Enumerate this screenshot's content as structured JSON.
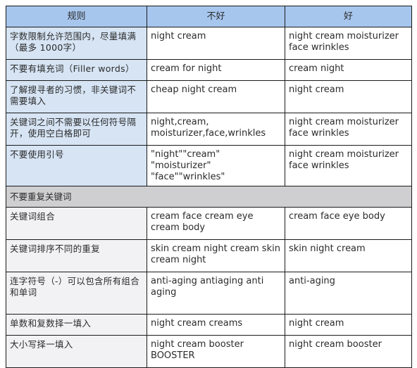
{
  "table": {
    "headers": [
      "规则",
      "不好",
      "好"
    ],
    "rows": [
      {
        "rule": "字数限制允许范围内，尽量填满（最多 1000字）",
        "bad": "night cream",
        "good": "night cream moisturizer face wrinkles"
      },
      {
        "rule": "不要有填充词（Filler words）",
        "bad": "cream for night",
        "good": "cream night"
      },
      {
        "rule": "了解搜寻者的习惯，非关键词不需要填入",
        "bad": "cheap night cream",
        "good": "night cream"
      },
      {
        "rule": "关键词之间不需要以任何符号隔开，使用空白格即可",
        "bad": "night,cream, moisturizer,face,wrinkles",
        "good": "night cream moisturizer face wrinkles"
      },
      {
        "rule": "不要使用引号",
        "bad": "\"night\"\"cream\" \"moisturizer\" \"face\"\"wrinkles\"",
        "good": "night cream moisturizer face wrinkles"
      }
    ],
    "section_title": "不要重复关键词",
    "section_rows": [
      {
        "rule": "关键词组合",
        "bad": "cream face cream eye cream body",
        "good": "cream face eye body"
      },
      {
        "rule": "关键词排序不同的重复",
        "bad": "skin cream night cream skin cream night",
        "good": "skin night cream"
      },
      {
        "rule": "连字符号（-）可以包含所有组合和单词",
        "bad": "anti-aging antiaging anti aging",
        "good": "anti-aging"
      },
      {
        "rule": "单数和复数择一填入",
        "bad": "night cream creams",
        "good": "night cream"
      },
      {
        "rule": "大小写择一填入",
        "bad": "night cream booster BOOSTER",
        "good": "night cream booster"
      }
    ]
  },
  "colors": {
    "header_bg": "#a7c6ee",
    "rule_cell_bg_top": "#d6e4f4",
    "rule_cell_bg_bottom": "#f2f2f4",
    "section_bg": "#cfcfd1",
    "border": "#1a1a1a"
  }
}
